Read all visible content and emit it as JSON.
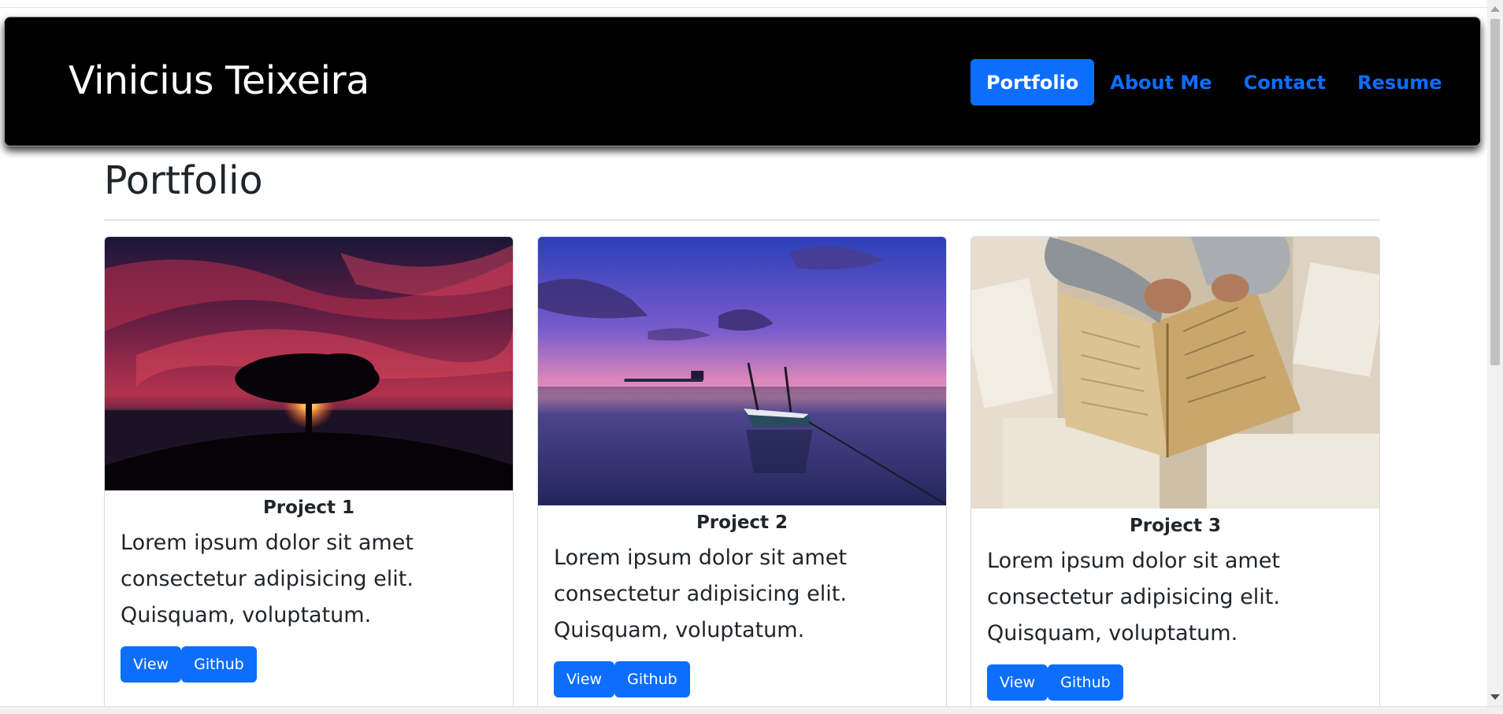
{
  "brand": "Vinicius Teixeira",
  "nav": {
    "items": [
      {
        "label": "Portfolio",
        "active": true
      },
      {
        "label": "About Me",
        "active": false
      },
      {
        "label": "Contact",
        "active": false
      },
      {
        "label": "Resume",
        "active": false
      }
    ]
  },
  "section": {
    "title": "Portfolio"
  },
  "cards": [
    {
      "title": "Project 1",
      "text": "Lorem ipsum dolor sit amet consectetur adipisicing elit. Quisquam, voluptatum.",
      "image": "tree-sunset-photo",
      "view_label": "View",
      "github_label": "Github"
    },
    {
      "title": "Project 2",
      "text": "Lorem ipsum dolor sit amet consectetur adipisicing elit. Quisquam, voluptatum.",
      "image": "boat-lake-photo",
      "view_label": "View",
      "github_label": "Github"
    },
    {
      "title": "Project 3",
      "text": "Lorem ipsum dolor sit amet consectetur adipisicing elit. Quisquam, voluptatum.",
      "image": "open-books-photo",
      "view_label": "View",
      "github_label": "Github"
    }
  ],
  "colors": {
    "primary": "#0d6efd",
    "navbar_bg": "#000000",
    "text": "#212529"
  }
}
